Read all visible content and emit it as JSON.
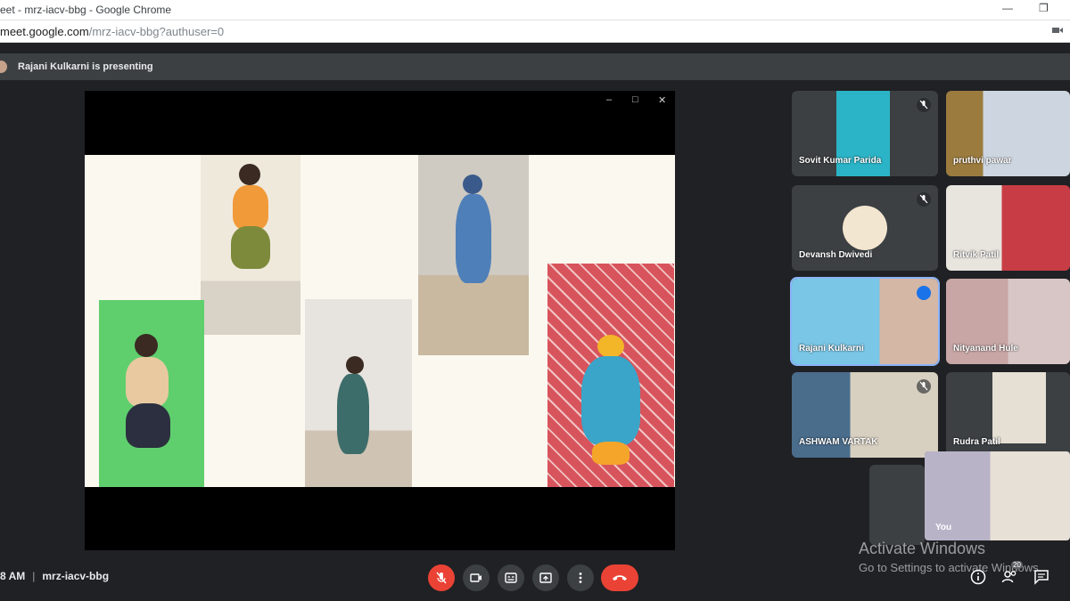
{
  "browser": {
    "window_title": "eet - mrz-iacv-bbg - Google Chrome",
    "url_host": "meet.google.com",
    "url_path": "/mrz-iacv-bbg?authuser=0"
  },
  "banner": {
    "text": "Rajani Kulkarni is presenting"
  },
  "participants": [
    {
      "name": "Sovit Kumar Parida",
      "muted": true
    },
    {
      "name": "pruthvi pawar",
      "muted": false
    },
    {
      "name": "Devansh Dwivedi",
      "muted": true
    },
    {
      "name": "Ritvik Patil",
      "muted": false
    },
    {
      "name": "Rajani Kulkarni",
      "muted": false,
      "speaking": true
    },
    {
      "name": "Nityanand Hule",
      "muted": false
    },
    {
      "name": "ASHWAM VARTAK",
      "muted": true
    },
    {
      "name": "Rudra Patil",
      "muted": false
    }
  ],
  "self_tile": {
    "label": "You"
  },
  "watermark": {
    "title": "Activate Windows",
    "subtitle": "Go to Settings to activate Windows."
  },
  "meeting": {
    "time": "8 AM",
    "separator": "|",
    "code": "mrz-iacv-bbg"
  },
  "colors": {
    "background": "#202124",
    "tile": "#3c4043",
    "danger": "#ea4335",
    "speaking_outline": "#8ab4f8"
  },
  "controls": {
    "mic": "mic-off-icon",
    "camera": "camera-icon",
    "captions": "captions-icon",
    "present": "present-icon",
    "more": "more-icon",
    "end_call": "end-call-icon",
    "info": "info-icon",
    "people": "people-icon",
    "people_count": "20",
    "chat": "chat-icon"
  }
}
